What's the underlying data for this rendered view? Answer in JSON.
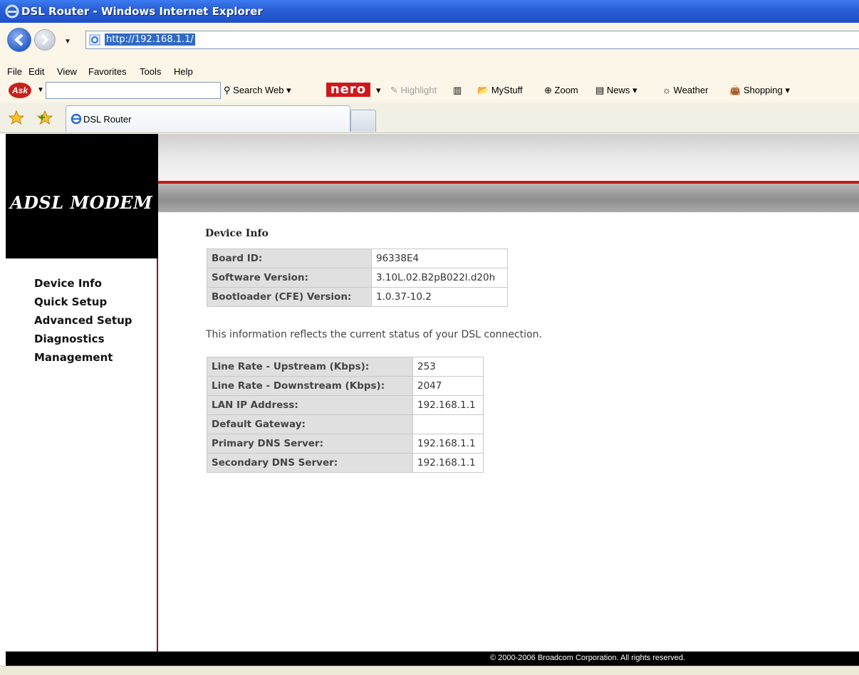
{
  "window": {
    "title": "DSL Router - Windows Internet Explorer"
  },
  "address": {
    "url": "http://192.168.1.1/"
  },
  "menu": [
    "File",
    "Edit",
    "View",
    "Favorites",
    "Tools",
    "Help"
  ],
  "toolbar": {
    "search_web": "Search Web",
    "nero": "nero",
    "highlight": "Highlight",
    "mystuff": "MyStuff",
    "zoom": "Zoom",
    "news": "News",
    "weather": "Weather",
    "shopping": "Shopping"
  },
  "tabs": [
    {
      "label": "DSL Router"
    }
  ],
  "page": {
    "brand": "ADSL MODEM",
    "nav": [
      "Device Info",
      "Quick Setup",
      "Advanced Setup",
      "Diagnostics",
      "Management"
    ],
    "section_title": "Device Info",
    "device_table": [
      {
        "label": "Board ID:",
        "value": "96338E4"
      },
      {
        "label": "Software Version:",
        "value": "3.10L.02.B2pB022l.d20h"
      },
      {
        "label": "Bootloader (CFE) Version:",
        "value": "1.0.37-10.2"
      }
    ],
    "description": "This information reflects the current status of your DSL connection.",
    "status_table": [
      {
        "label": "Line Rate - Upstream (Kbps):",
        "value": "253"
      },
      {
        "label": "Line Rate - Downstream (Kbps):",
        "value": "2047"
      },
      {
        "label": "LAN IP Address:",
        "value": "192.168.1.1"
      },
      {
        "label": "Default Gateway:",
        "value": ""
      },
      {
        "label": "Primary DNS Server:",
        "value": "192.168.1.1"
      },
      {
        "label": "Secondary DNS Server:",
        "value": "192.168.1.1"
      }
    ],
    "footer": "© 2000-2006 Broadcom Corporation. All rights reserved."
  }
}
